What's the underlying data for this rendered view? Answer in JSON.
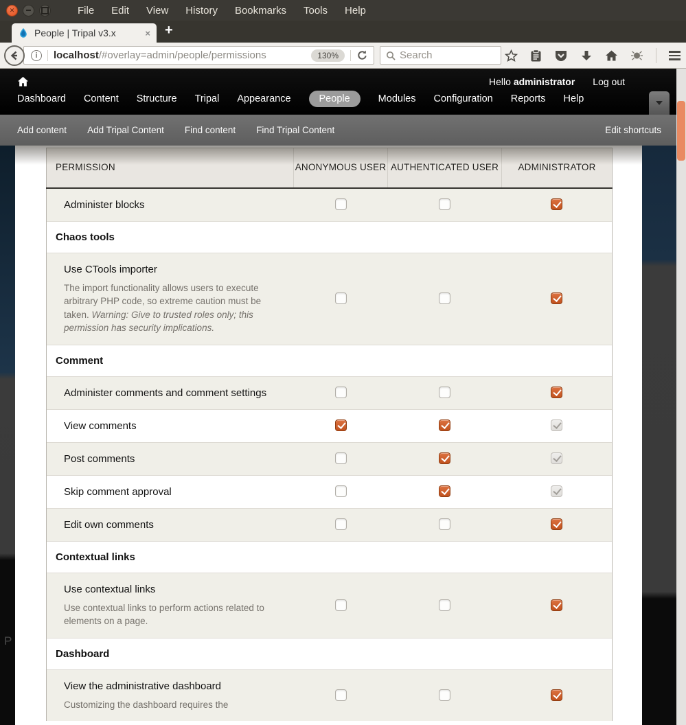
{
  "browser": {
    "menubar": [
      "File",
      "Edit",
      "View",
      "History",
      "Bookmarks",
      "Tools",
      "Help"
    ],
    "tab": {
      "title": "People | Tripal v3.x",
      "close_glyph": "×",
      "new_tab_glyph": "+"
    },
    "urlbar": {
      "host": "localhost",
      "path": "/#overlay=admin/people/permissions",
      "zoom": "130%"
    },
    "search": {
      "placeholder": "Search"
    }
  },
  "admin_toolbar": {
    "greeting_prefix": "Hello ",
    "username": "administrator",
    "logout": "Log out",
    "menu": [
      {
        "label": "Dashboard",
        "active": false
      },
      {
        "label": "Content",
        "active": false
      },
      {
        "label": "Structure",
        "active": false
      },
      {
        "label": "Tripal",
        "active": false
      },
      {
        "label": "Appearance",
        "active": false
      },
      {
        "label": "People",
        "active": true
      },
      {
        "label": "Modules",
        "active": false
      },
      {
        "label": "Configuration",
        "active": false
      },
      {
        "label": "Reports",
        "active": false
      },
      {
        "label": "Help",
        "active": false
      }
    ]
  },
  "shortcut_bar": {
    "links": [
      "Add content",
      "Add Tripal Content",
      "Find content",
      "Find Tripal Content"
    ],
    "edit_label": "Edit shortcuts"
  },
  "permissions": {
    "columns": [
      "PERMISSION",
      "ANONYMOUS USER",
      "AUTHENTICATED USER",
      "ADMINISTRATOR"
    ],
    "rows": [
      {
        "type": "permission",
        "name": "Administer blocks",
        "shaded": true,
        "states": [
          "unchecked",
          "unchecked",
          "checked"
        ]
      },
      {
        "type": "section",
        "title": "Chaos tools"
      },
      {
        "type": "permission",
        "name": "Use CTools importer",
        "shaded": true,
        "description": "The import functionality allows users to execute arbitrary PHP code, so extreme caution must be taken. ",
        "description_italic": "Warning: Give to trusted roles only; this permission has security implications.",
        "states": [
          "unchecked",
          "unchecked",
          "checked"
        ]
      },
      {
        "type": "section",
        "title": "Comment"
      },
      {
        "type": "permission",
        "name": "Administer comments and comment settings",
        "shaded": true,
        "states": [
          "unchecked",
          "unchecked",
          "checked"
        ]
      },
      {
        "type": "permission",
        "name": "View comments",
        "shaded": false,
        "states": [
          "checked",
          "checked",
          "checked-disabled"
        ]
      },
      {
        "type": "permission",
        "name": "Post comments",
        "shaded": true,
        "states": [
          "unchecked",
          "checked",
          "checked-disabled"
        ]
      },
      {
        "type": "permission",
        "name": "Skip comment approval",
        "shaded": false,
        "states": [
          "unchecked",
          "checked",
          "checked-disabled"
        ]
      },
      {
        "type": "permission",
        "name": "Edit own comments",
        "shaded": true,
        "states": [
          "unchecked",
          "unchecked",
          "checked"
        ]
      },
      {
        "type": "section",
        "title": "Contextual links"
      },
      {
        "type": "permission",
        "name": "Use contextual links",
        "shaded": true,
        "description": "Use contextual links to perform actions related to elements on a page.",
        "states": [
          "unchecked",
          "unchecked",
          "checked"
        ]
      },
      {
        "type": "section",
        "title": "Dashboard"
      },
      {
        "type": "permission",
        "name": "View the administrative dashboard",
        "shaded": true,
        "description": "Customizing the dashboard requires the",
        "states": [
          "unchecked",
          "unchecked",
          "checked"
        ]
      }
    ]
  },
  "background": {
    "dimmed_text": "P"
  },
  "colors": {
    "accent_orange_checkbox": "#c1521f",
    "ubuntu_close_orange": "#e1521f",
    "scrollbar_thumb": "#e98a62",
    "toolbar_black": "#000000",
    "shortcut_gray": "#666666",
    "row_shade": "#f0efe8",
    "header_bg": "#e9e6e1",
    "dim_navy": "#16293c"
  }
}
